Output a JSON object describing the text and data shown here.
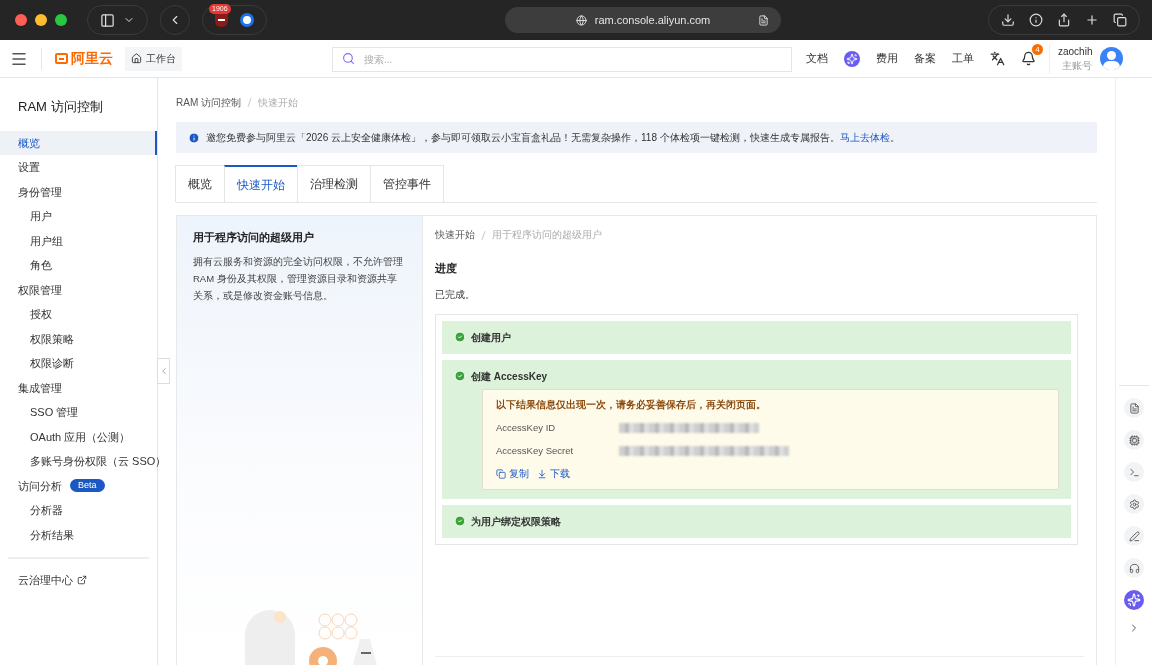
{
  "browser": {
    "badge_count": "1906",
    "url": "ram.console.aliyun.com"
  },
  "header": {
    "logo": "阿里云",
    "workbench": "工作台",
    "search_placeholder": "搜索...",
    "links": [
      {
        "kind": "text",
        "label": "文档"
      },
      {
        "kind": "ai"
      },
      {
        "kind": "text",
        "label": "费用"
      },
      {
        "kind": "text",
        "label": "备案"
      },
      {
        "kind": "text",
        "label": "工单"
      },
      {
        "kind": "translate"
      },
      {
        "kind": "bell",
        "count": "4"
      }
    ],
    "user": "zaochih",
    "account_type": "主账号"
  },
  "sidebar": {
    "title": "RAM 访问控制",
    "items": [
      {
        "label": "概览",
        "selected": true
      },
      {
        "label": "设置",
        "selected": false
      },
      {
        "label": "身份管理",
        "selected": false,
        "children": [
          {
            "label": "用户",
            "selected": false
          },
          {
            "label": "用户组",
            "selected": false
          },
          {
            "label": "角色",
            "selected": false
          }
        ]
      },
      {
        "label": "权限管理",
        "selected": false,
        "children": [
          {
            "label": "授权",
            "selected": false
          },
          {
            "label": "权限策略",
            "selected": false
          },
          {
            "label": "权限诊断",
            "selected": false
          }
        ]
      },
      {
        "label": "集成管理",
        "selected": false,
        "children": [
          {
            "label": "SSO 管理",
            "selected": false
          },
          {
            "label": "OAuth 应用（公测）",
            "selected": false
          },
          {
            "label": "多账号身份权限（云 SSO）",
            "selected": false
          }
        ]
      },
      {
        "label": "访问分析",
        "badge": "Beta",
        "selected": false,
        "children": [
          {
            "label": "分析器",
            "selected": false
          },
          {
            "label": "分析结果",
            "selected": false
          }
        ]
      }
    ],
    "footer_link": "云治理中心"
  },
  "breadcrumb": [
    "RAM 访问控制",
    "快速开始"
  ],
  "notice": {
    "text": "邀您免费参与阿里云「2026 云上安全健康体检」，参与即可领取云小宝盲盒礼品！无需复杂操作，118 个体检项一键检测，快速生成专属报告。",
    "link": "马上去体检",
    "suffix": "。"
  },
  "tabs": [
    {
      "label": "概览",
      "selected": false
    },
    {
      "label": "快速开始",
      "selected": true
    },
    {
      "label": "治理检测",
      "selected": false
    },
    {
      "label": "管控事件",
      "selected": false
    }
  ],
  "intro": {
    "title": "用于程序访问的超级用户",
    "description": "拥有云服务和资源的完全访问权限，不允许管理 RAM 身份及其权限，管理资源目录和资源共享关系，或是修改资金账号信息。"
  },
  "detail": {
    "breadcrumb": [
      "快速开始",
      "用于程序访问的超级用户"
    ],
    "heading": "进度",
    "status": "已完成。",
    "steps": [
      {
        "label": "创建用户",
        "done": true
      },
      {
        "label": "创建 AccessKey",
        "done": true,
        "result": {
          "warning": "以下结果信息仅出现一次，请务必妥善保存后，再关闭页面。",
          "fields": [
            {
              "label": "AccessKey ID"
            },
            {
              "label": "AccessKey Secret"
            }
          ],
          "actions": [
            {
              "kind": "copy",
              "label": "复制"
            },
            {
              "kind": "download",
              "label": "下载"
            }
          ]
        }
      },
      {
        "label": "为用户绑定权限策略",
        "done": true
      }
    ]
  }
}
